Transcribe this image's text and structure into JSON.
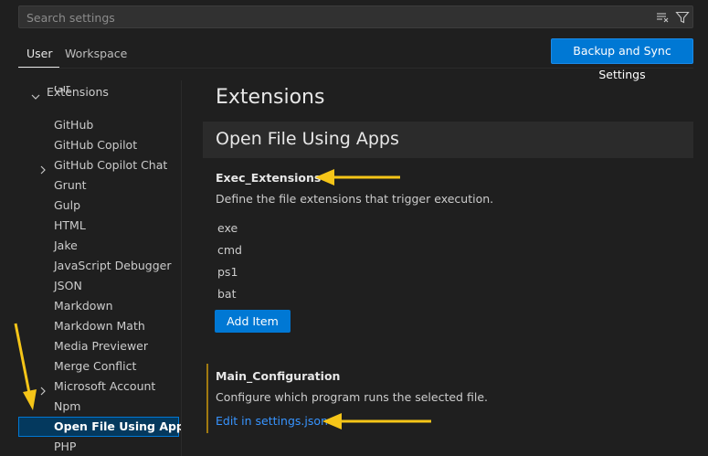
{
  "search": {
    "placeholder": "Search settings",
    "clear_icon": "clear-filter-icon",
    "filter_icon": "filter-icon"
  },
  "scope_tabs": [
    {
      "label": "User",
      "selected": true
    },
    {
      "label": "Workspace",
      "selected": false
    }
  ],
  "sync_button": {
    "label": "Backup and Sync Settings"
  },
  "toc": {
    "group": {
      "label": "Extensions",
      "expanded": true
    },
    "items": [
      {
        "label": "Git"
      },
      {
        "label": "GitHub"
      },
      {
        "label": "GitHub Copilot"
      },
      {
        "label": "GitHub Copilot Chat",
        "collapsible": true
      },
      {
        "label": "Grunt"
      },
      {
        "label": "Gulp"
      },
      {
        "label": "HTML"
      },
      {
        "label": "Jake"
      },
      {
        "label": "JavaScript Debugger"
      },
      {
        "label": "JSON"
      },
      {
        "label": "Markdown"
      },
      {
        "label": "Markdown Math"
      },
      {
        "label": "Media Previewer"
      },
      {
        "label": "Merge Conflict"
      },
      {
        "label": "Microsoft Account",
        "collapsible": true
      },
      {
        "label": "Npm"
      },
      {
        "label": "Open File Using Apps",
        "selected": true
      },
      {
        "label": "PHP"
      }
    ]
  },
  "main": {
    "section_title": "Extensions",
    "group_title": "Open File Using Apps",
    "exec_setting": {
      "title": "Exec_Extensions",
      "description": "Define the file extensions that trigger execution.",
      "values": [
        "exe",
        "cmd",
        "ps1",
        "bat"
      ],
      "add_button": "Add Item"
    },
    "main_config_setting": {
      "title": "Main_Configuration",
      "description": "Configure which program runs the selected file.",
      "link": "Edit in settings.json"
    }
  },
  "colors": {
    "accent": "#0078d4",
    "annotation_arrow": "#f5c518",
    "link": "#3794ff",
    "background": "#1f1f1f"
  }
}
